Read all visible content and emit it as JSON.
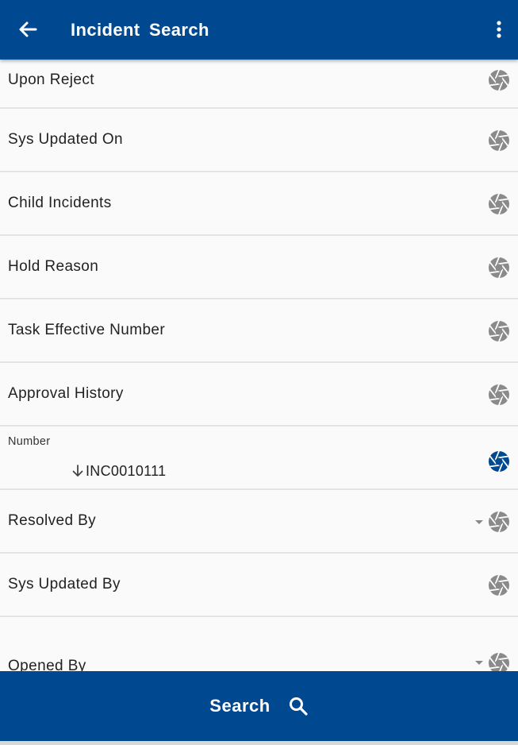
{
  "header": {
    "title": "Incident  Search",
    "back_icon": "arrow-left-icon",
    "menu_icon": "more-vertical-icon",
    "background": "#004990"
  },
  "fields": [
    {
      "label": "Upon Reject",
      "icon": "aperture-icon",
      "dropdown": false
    },
    {
      "label": "Sys Updated On",
      "icon": "aperture-icon",
      "dropdown": false
    },
    {
      "label": "Child Incidents",
      "icon": "aperture-icon",
      "dropdown": false
    },
    {
      "label": "Hold Reason",
      "icon": "aperture-icon",
      "dropdown": false
    },
    {
      "label": "Task Effective Number",
      "icon": "aperture-icon",
      "dropdown": false
    },
    {
      "label": "Approval History",
      "icon": "aperture-icon",
      "dropdown": false
    },
    {
      "label": "Number",
      "value": "INC0010111",
      "value_icon": "arrow-down-icon",
      "icon": "aperture-icon",
      "active": true,
      "active_color": "#004990"
    },
    {
      "label": "Resolved By",
      "icon": "aperture-icon",
      "dropdown": true
    },
    {
      "label": "Sys Updated By",
      "icon": "aperture-icon",
      "dropdown": false
    },
    {
      "label": "Opened By",
      "icon": "aperture-icon",
      "dropdown": true
    }
  ],
  "footer": {
    "search_label": "Search",
    "search_icon": "search-icon"
  },
  "colors": {
    "primary": "#004990",
    "icon_inactive": "#8a8a8a",
    "divider": "#e4e4e4"
  }
}
